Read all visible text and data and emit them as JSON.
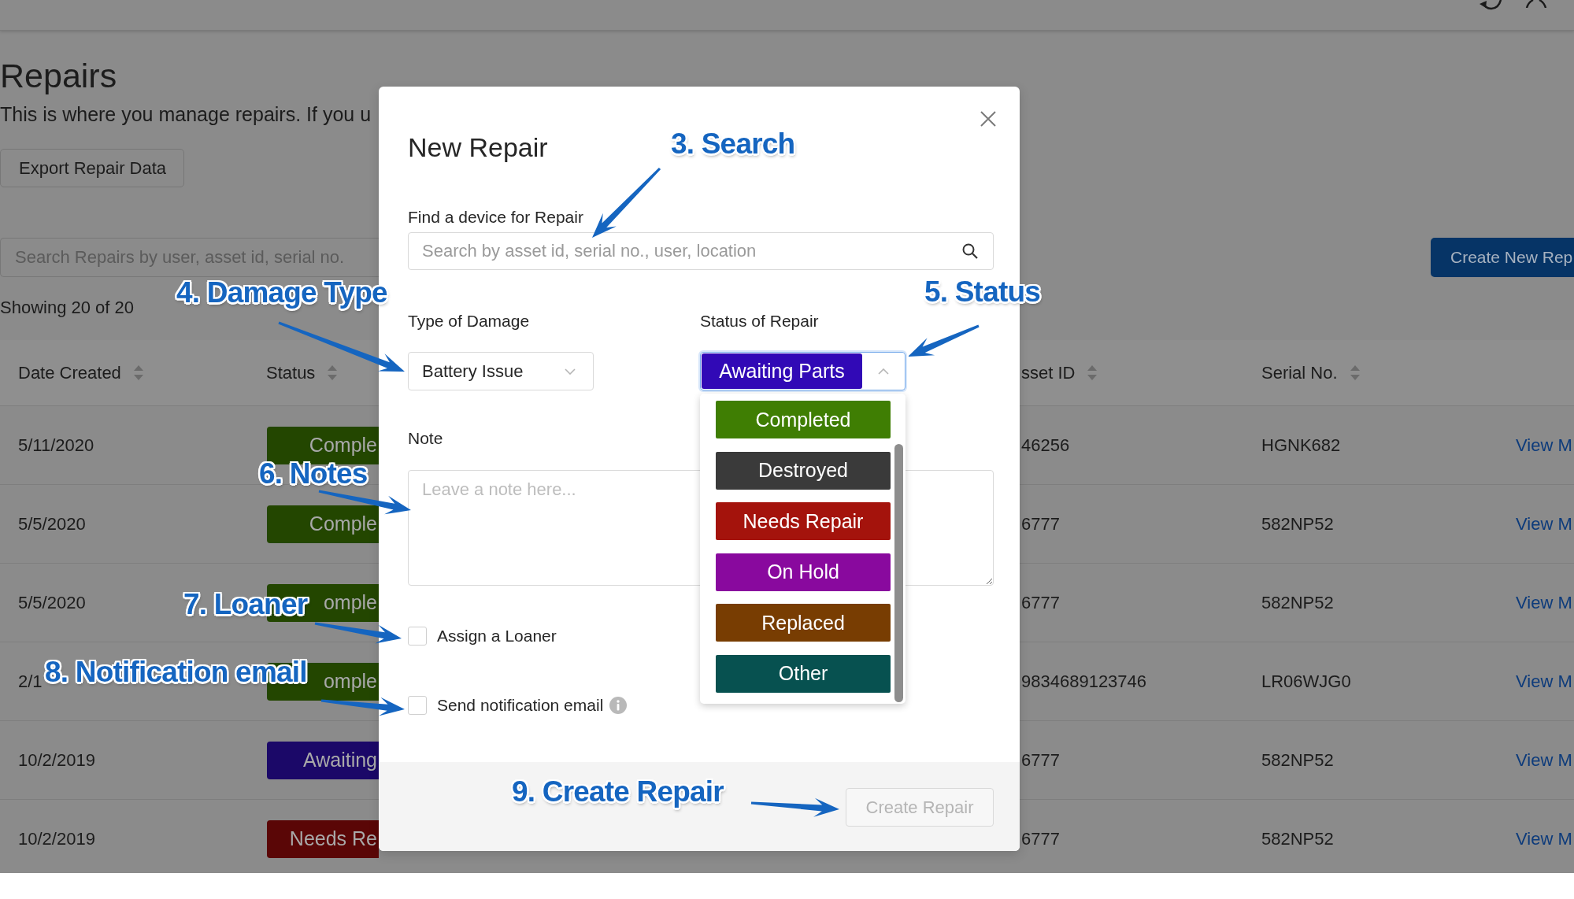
{
  "page": {
    "title": "Repairs",
    "description": "This is where you manage repairs. If you u",
    "export_button": "Export Repair Data",
    "search": {
      "placeholder": "Search Repairs by user, asset id, serial no."
    },
    "create_button": "Create New Rep",
    "count": "Showing 20 of 20"
  },
  "table": {
    "columns": [
      "Date Created",
      "Status",
      "sset ID",
      "Serial No."
    ],
    "rows": [
      {
        "date": "5/11/2020",
        "status": {
          "label": "Comple",
          "color": "#234600"
        },
        "asset_id": "46256",
        "serial": "HGNK682",
        "link": "View M"
      },
      {
        "date": "5/5/2020",
        "status": {
          "label": "Comple",
          "color": "#234600"
        },
        "asset_id": "6777",
        "serial": "582NP52",
        "link": "View M"
      },
      {
        "date": "5/5/2020",
        "status": {
          "label": "omple",
          "color": "#234600"
        },
        "asset_id": "6777",
        "serial": "582NP52",
        "link": "View M"
      },
      {
        "date": "2/1",
        "status": {
          "label": "omple",
          "color": "#234600"
        },
        "asset_id": "9834689123746",
        "serial": "LR06WJG0",
        "link": "View M"
      },
      {
        "date": "10/2/2019",
        "status": {
          "label": "Awaiting",
          "color": "#1b0868"
        },
        "asset_id": "6777",
        "serial": "582NP52",
        "link": "View M"
      },
      {
        "date": "10/2/2019",
        "status": {
          "label": "Needs Re",
          "color": "#5a0606"
        },
        "asset_id": "6777",
        "serial": "582NP52",
        "link": "View M"
      }
    ]
  },
  "modal": {
    "title": "New Repair",
    "device_search": {
      "label": "Find a device for Repair",
      "placeholder": "Search by asset id, serial no., user, location"
    },
    "damage": {
      "label": "Type of Damage",
      "value": "Battery Issue"
    },
    "status": {
      "label": "Status of Repair",
      "value": {
        "label": "Awaiting Parts",
        "color": "#3109b6"
      },
      "expanded": true,
      "options": [
        {
          "label": "Completed",
          "color": "#3f7e03",
          "selected": false
        },
        {
          "label": "Destroyed",
          "color": "#3a3a3a",
          "selected": false
        },
        {
          "label": "Needs Repair",
          "color": "#a4130c",
          "selected": false
        },
        {
          "label": "On Hold",
          "color": "#89099e",
          "selected": false
        },
        {
          "label": "Replaced",
          "color": "#783d02",
          "selected": false
        },
        {
          "label": "Other",
          "color": "#075150",
          "selected": false
        }
      ]
    },
    "note": {
      "label": "Note",
      "placeholder": "Leave a note here..."
    },
    "checkboxes": [
      {
        "label": "Assign a Loaner",
        "checked": false,
        "info": false
      },
      {
        "label": "Send notification email",
        "checked": false,
        "info": true
      }
    ],
    "create_button": {
      "label": "Create Repair",
      "disabled": true
    }
  },
  "callouts": [
    "3. Search",
    "4. Damage Type",
    "5. Status",
    "6. Notes",
    "7. Loaner",
    "8. Notification email",
    "9. Create Repair"
  ]
}
